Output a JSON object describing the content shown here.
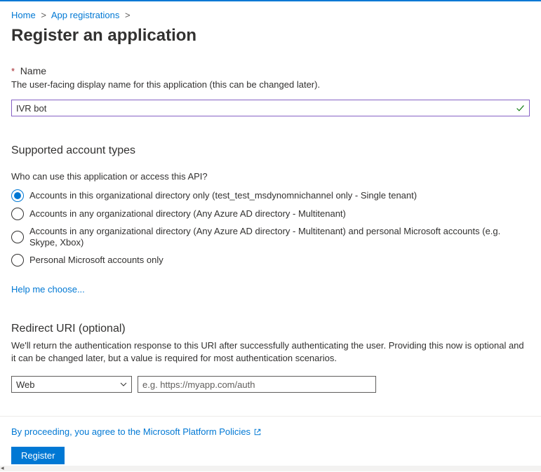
{
  "breadcrumb": {
    "home": "Home",
    "app_registrations": "App registrations"
  },
  "page_title": "Register an application",
  "name_section": {
    "label": "Name",
    "hint": "The user-facing display name for this application (this can be changed later).",
    "value": "IVR bot"
  },
  "account_types": {
    "title": "Supported account types",
    "question": "Who can use this application or access this API?",
    "options": [
      "Accounts in this organizational directory only (test_test_msdynomnichannel only - Single tenant)",
      "Accounts in any organizational directory (Any Azure AD directory - Multitenant)",
      "Accounts in any organizational directory (Any Azure AD directory - Multitenant) and personal Microsoft accounts (e.g. Skype, Xbox)",
      "Personal Microsoft accounts only"
    ],
    "help_link": "Help me choose..."
  },
  "redirect": {
    "title": "Redirect URI (optional)",
    "description": "We'll return the authentication response to this URI after successfully authenticating the user. Providing this now is optional and it can be changed later, but a value is required for most authentication scenarios.",
    "platform_selected": "Web",
    "uri_placeholder": "e.g. https://myapp.com/auth"
  },
  "footer": {
    "policy_link": "By proceeding, you agree to the Microsoft Platform Policies",
    "register_button": "Register"
  }
}
